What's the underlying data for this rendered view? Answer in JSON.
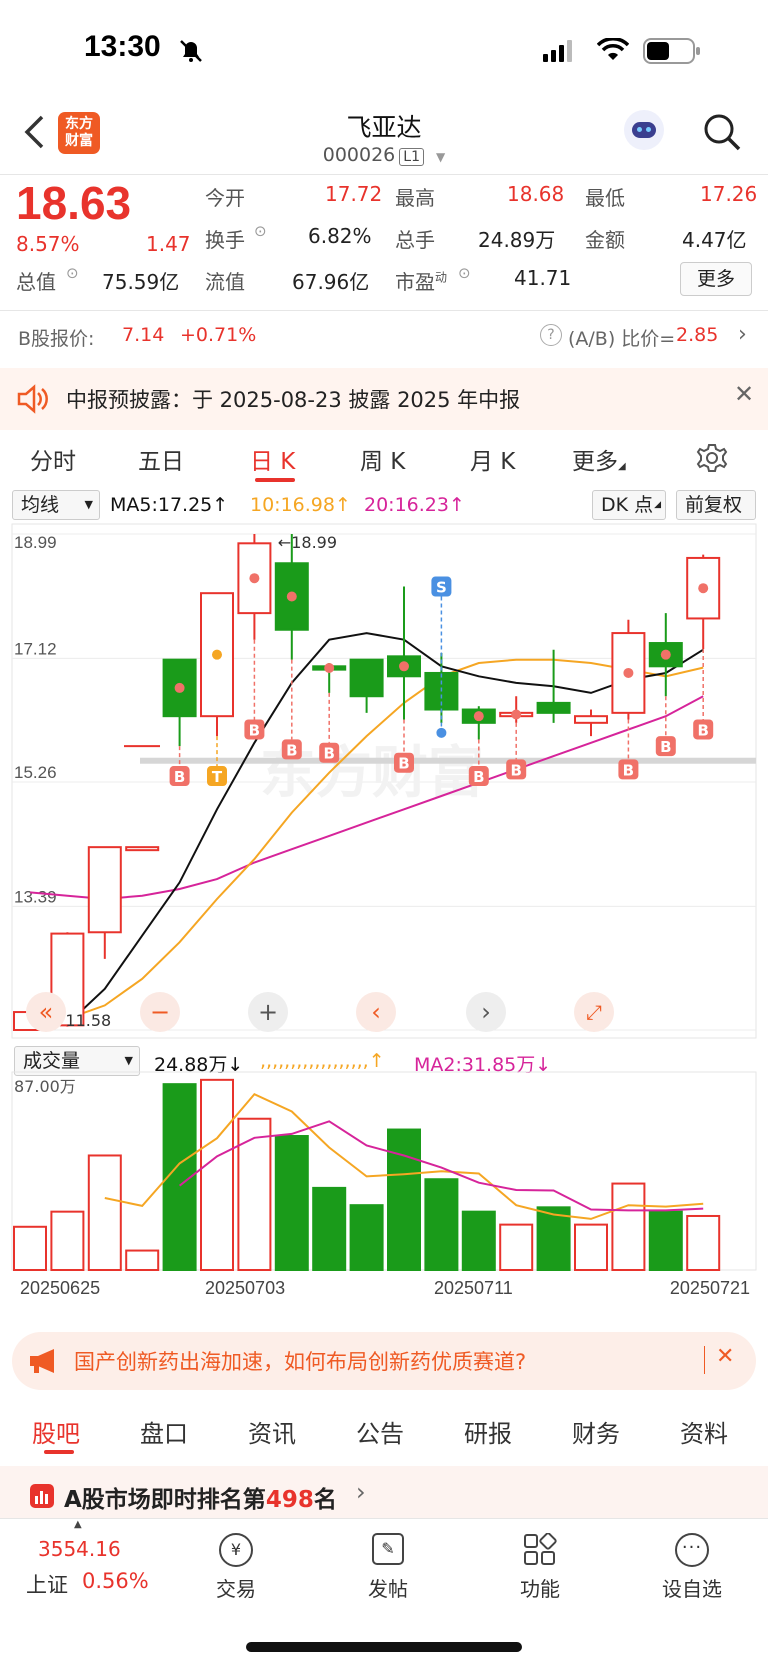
{
  "status": {
    "time": "13:30"
  },
  "header": {
    "logo_text": "东方\n财富",
    "title": "飞亚达",
    "code": "000026",
    "level": "L1"
  },
  "quote": {
    "price": "18.63",
    "pct": "8.57%",
    "change": "1.47",
    "rows": [
      [
        {
          "label": "今开",
          "value": "17.72",
          "color": "red"
        },
        {
          "label": "最高",
          "value": "18.68",
          "color": "red"
        },
        {
          "label": "最低",
          "value": "17.26",
          "color": "red"
        }
      ],
      [
        {
          "label": "换手",
          "value": "6.82%",
          "color": "black"
        },
        {
          "label": "总手",
          "value": "24.89万",
          "color": "black"
        },
        {
          "label": "金额",
          "value": "4.47亿",
          "color": "black"
        }
      ],
      [
        {
          "label": "总值",
          "value": "75.59亿",
          "color": "black"
        },
        {
          "label": "流值",
          "value": "67.96亿",
          "color": "black"
        },
        {
          "label": "市盈",
          "value": "41.71",
          "color": "black"
        }
      ]
    ],
    "pe_superscript": "动",
    "more_label": "更多"
  },
  "bshare": {
    "label": "B股报价:",
    "price": "7.14",
    "pct": "+0.71%",
    "ratio_label": "(A/B) 比价=",
    "ratio": "2.85"
  },
  "notice": {
    "text": "中报预披露：于 2025-08-23 披露 2025 年中报"
  },
  "tabs": [
    "分时",
    "五日",
    "日 K",
    "周 K",
    "月 K",
    "更多"
  ],
  "active_tab": "日 K",
  "indicator": {
    "dropdown": "均线",
    "ma5": "MA5:17.25",
    "ma10": "10:16.98",
    "ma20": "20:16.23",
    "dk_label": "DK 点",
    "adjust_label": "前复权",
    "ma5_color": "#111111",
    "ma10_color": "#f5a623",
    "ma20_color": "#d6249a"
  },
  "chart_data": {
    "type": "candlestick",
    "y_ticks": [
      "18.99",
      "17.12",
      "15.26",
      "13.39",
      "11.53"
    ],
    "ylim": [
      11.53,
      18.99
    ],
    "max_label": "18.99",
    "min_label": "11.58",
    "candles": [
      {
        "o": 11.53,
        "c": 11.8,
        "h": 11.85,
        "l": 11.53
      },
      {
        "o": 11.6,
        "c": 12.98,
        "h": 13.0,
        "l": 11.58
      },
      {
        "o": 13.0,
        "c": 14.28,
        "h": 14.28,
        "l": 12.6
      },
      {
        "o": 14.28,
        "c": 14.28,
        "h": 14.28,
        "l": 14.28
      },
      {
        "o": 17.1,
        "c": 16.25,
        "h": 17.1,
        "l": 15.8
      },
      {
        "o": 16.25,
        "c": 18.1,
        "h": 18.1,
        "l": 15.95
      },
      {
        "o": 17.8,
        "c": 18.85,
        "h": 18.99,
        "l": 17.4
      },
      {
        "o": 18.55,
        "c": 17.55,
        "h": 18.99,
        "l": 17.1
      },
      {
        "o": 17.0,
        "c": 16.95,
        "h": 17.05,
        "l": 16.6
      },
      {
        "o": 17.1,
        "c": 16.55,
        "h": 17.1,
        "l": 16.3
      },
      {
        "o": 17.15,
        "c": 16.85,
        "h": 18.2,
        "l": 16.2
      },
      {
        "o": 16.9,
        "c": 16.35,
        "h": 17.2,
        "l": 16.15
      },
      {
        "o": 16.35,
        "c": 16.15,
        "h": 16.4,
        "l": 15.9
      },
      {
        "o": 16.25,
        "c": 16.3,
        "h": 16.55,
        "l": 16.15
      },
      {
        "o": 16.45,
        "c": 16.3,
        "h": 17.25,
        "l": 16.15
      },
      {
        "o": 16.15,
        "c": 16.25,
        "h": 16.35,
        "l": 15.95
      },
      {
        "o": 16.3,
        "c": 17.5,
        "h": 17.7,
        "l": 16.2
      },
      {
        "o": 17.35,
        "c": 17.0,
        "h": 17.8,
        "l": 16.55
      },
      {
        "o": 17.72,
        "c": 18.63,
        "h": 18.68,
        "l": 17.26
      }
    ],
    "ma5": [
      11.55,
      11.62,
      12.15,
      12.95,
      13.75,
      14.85,
      15.85,
      16.75,
      17.4,
      17.5,
      17.4,
      17.0,
      16.85,
      16.75,
      16.7,
      16.6,
      16.8,
      16.9,
      17.25
    ],
    "ma10": [
      null,
      11.7,
      11.9,
      12.3,
      12.85,
      13.5,
      14.1,
      14.8,
      15.4,
      15.95,
      16.45,
      16.85,
      17.05,
      17.1,
      17.1,
      17.05,
      16.95,
      16.85,
      16.98
    ],
    "ma20": [
      13.6,
      13.55,
      13.5,
      13.55,
      13.65,
      13.8,
      14.05,
      14.25,
      14.45,
      14.65,
      14.85,
      15.05,
      15.25,
      15.45,
      15.65,
      15.85,
      16.05,
      16.25,
      16.55
    ],
    "markers": [
      {
        "i": 4,
        "text": "B",
        "type": "B",
        "price": 15.35
      },
      {
        "i": 5,
        "text": "T",
        "type": "T",
        "price": 15.35
      },
      {
        "i": 6,
        "text": "B",
        "type": "B",
        "price": 16.05
      },
      {
        "i": 7,
        "text": "B",
        "type": "B",
        "price": 15.75
      },
      {
        "i": 8,
        "text": "B",
        "type": "B",
        "price": 15.7
      },
      {
        "i": 10,
        "text": "B",
        "type": "B",
        "price": 15.55
      },
      {
        "i": 11,
        "text": "S",
        "type": "S",
        "price": 18.2
      },
      {
        "i": 12,
        "text": "B",
        "type": "B",
        "price": 15.35
      },
      {
        "i": 13,
        "text": "B",
        "type": "B",
        "price": 15.45
      },
      {
        "i": 16,
        "text": "B",
        "type": "B",
        "price": 15.45
      },
      {
        "i": 17,
        "text": "B",
        "type": "B",
        "price": 15.8
      },
      {
        "i": 18,
        "text": "B",
        "type": "B",
        "price": 16.05
      }
    ],
    "volume": {
      "dropdown": "成交量",
      "current": "24.88万",
      "ma1": [
        null,
        null,
        null,
        null,
        null,
        null,
        null,
        null,
        null,
        null,
        null,
        null,
        null,
        null,
        null,
        null,
        null,
        null,
        null
      ],
      "ma2": "MA2:31.85万",
      "max_label": "87.00万",
      "ylim": [
        0,
        87
      ],
      "values": [
        20,
        27,
        53,
        9,
        86,
        88,
        70,
        62,
        38,
        30,
        65,
        42,
        27,
        21,
        29,
        21,
        40,
        27,
        25
      ],
      "x_labels": [
        "20250625",
        "20250703",
        "20250711",
        "20250721"
      ]
    }
  },
  "banner": {
    "text": "国产创新药出海加速，如何布局创新药优质赛道?"
  },
  "subtabs": [
    "股吧",
    "盘口",
    "资讯",
    "公告",
    "研报",
    "财务",
    "资料"
  ],
  "rank": {
    "prefix": "A股市场即时排名第",
    "number": "498",
    "suffix": "名"
  },
  "bottombar": {
    "index_value": "3554.16",
    "index_name": "上证",
    "index_pct": "0.56%",
    "items": [
      "交易",
      "发帖",
      "功能",
      "设自选"
    ]
  }
}
